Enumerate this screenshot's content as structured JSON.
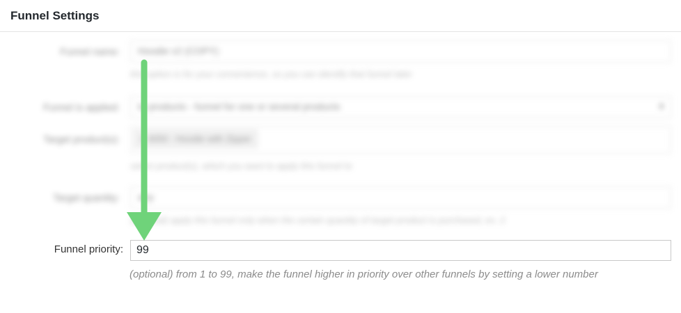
{
  "panel": {
    "title": "Funnel Settings"
  },
  "blurred": {
    "funnel_name_label": "Funnel name:",
    "funnel_name_value": "Hoodie v2 (COPY)",
    "funnel_name_help": "this option is for your convenience, so you can identify that funnel later",
    "funnel_applied_label": "Funnel is applied:",
    "funnel_applied_value": "to products - funnel for one or several products",
    "target_products_label": "Target product(s):",
    "target_products_chip": "× 4050 - Hoodie with Zipper",
    "target_products_help": "select product(s), which you want to apply this funnel to",
    "target_quantity_label": "Target quantity:",
    "target_quantity_value": "any",
    "target_quantity_help": "(optional) apply this funnel only when the certain quantity of target product is purchased, ex. 2"
  },
  "priority": {
    "label": "Funnel priority:",
    "value": "99",
    "help": "(optional) from 1 to 99, make the funnel higher in priority over other funnels by setting a lower number"
  },
  "colors": {
    "arrow": "#6fd37a"
  }
}
